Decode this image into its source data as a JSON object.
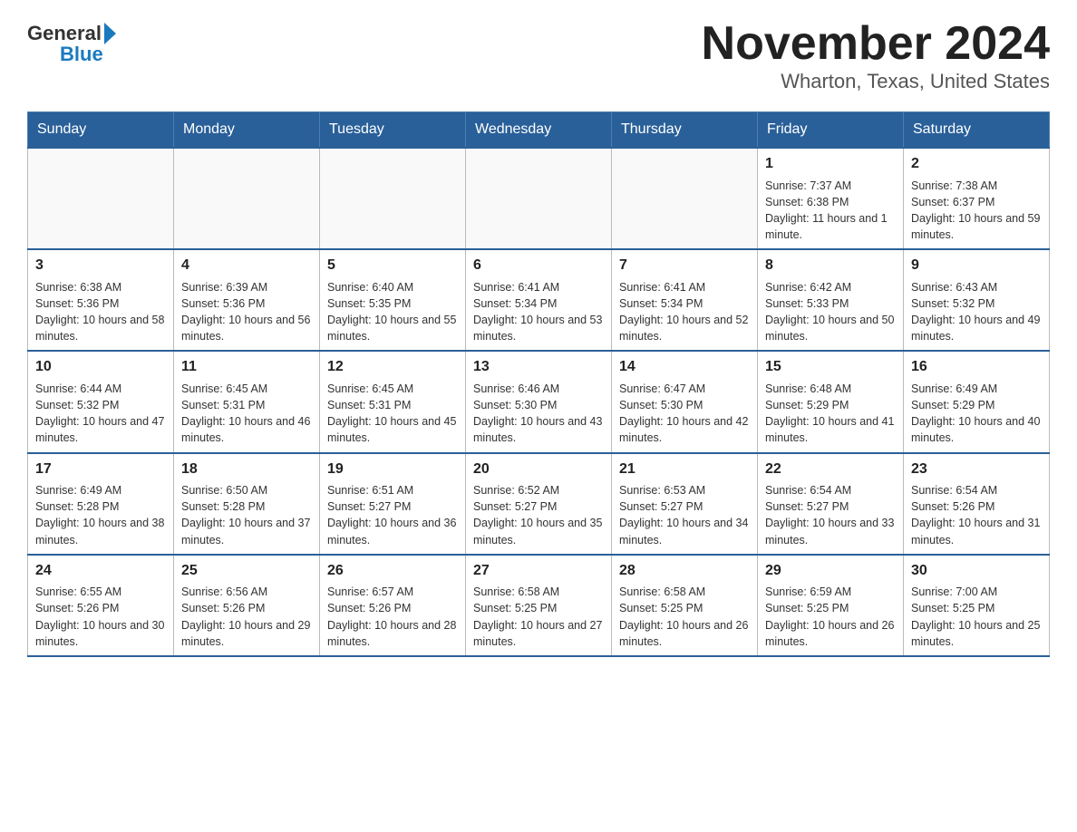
{
  "logo": {
    "general": "General",
    "blue": "Blue",
    "arrow": "▶"
  },
  "title": "November 2024",
  "subtitle": "Wharton, Texas, United States",
  "days_of_week": [
    "Sunday",
    "Monday",
    "Tuesday",
    "Wednesday",
    "Thursday",
    "Friday",
    "Saturday"
  ],
  "weeks": [
    [
      {
        "day": "",
        "info": ""
      },
      {
        "day": "",
        "info": ""
      },
      {
        "day": "",
        "info": ""
      },
      {
        "day": "",
        "info": ""
      },
      {
        "day": "",
        "info": ""
      },
      {
        "day": "1",
        "info": "Sunrise: 7:37 AM\nSunset: 6:38 PM\nDaylight: 11 hours and 1 minute."
      },
      {
        "day": "2",
        "info": "Sunrise: 7:38 AM\nSunset: 6:37 PM\nDaylight: 10 hours and 59 minutes."
      }
    ],
    [
      {
        "day": "3",
        "info": "Sunrise: 6:38 AM\nSunset: 5:36 PM\nDaylight: 10 hours and 58 minutes."
      },
      {
        "day": "4",
        "info": "Sunrise: 6:39 AM\nSunset: 5:36 PM\nDaylight: 10 hours and 56 minutes."
      },
      {
        "day": "5",
        "info": "Sunrise: 6:40 AM\nSunset: 5:35 PM\nDaylight: 10 hours and 55 minutes."
      },
      {
        "day": "6",
        "info": "Sunrise: 6:41 AM\nSunset: 5:34 PM\nDaylight: 10 hours and 53 minutes."
      },
      {
        "day": "7",
        "info": "Sunrise: 6:41 AM\nSunset: 5:34 PM\nDaylight: 10 hours and 52 minutes."
      },
      {
        "day": "8",
        "info": "Sunrise: 6:42 AM\nSunset: 5:33 PM\nDaylight: 10 hours and 50 minutes."
      },
      {
        "day": "9",
        "info": "Sunrise: 6:43 AM\nSunset: 5:32 PM\nDaylight: 10 hours and 49 minutes."
      }
    ],
    [
      {
        "day": "10",
        "info": "Sunrise: 6:44 AM\nSunset: 5:32 PM\nDaylight: 10 hours and 47 minutes."
      },
      {
        "day": "11",
        "info": "Sunrise: 6:45 AM\nSunset: 5:31 PM\nDaylight: 10 hours and 46 minutes."
      },
      {
        "day": "12",
        "info": "Sunrise: 6:45 AM\nSunset: 5:31 PM\nDaylight: 10 hours and 45 minutes."
      },
      {
        "day": "13",
        "info": "Sunrise: 6:46 AM\nSunset: 5:30 PM\nDaylight: 10 hours and 43 minutes."
      },
      {
        "day": "14",
        "info": "Sunrise: 6:47 AM\nSunset: 5:30 PM\nDaylight: 10 hours and 42 minutes."
      },
      {
        "day": "15",
        "info": "Sunrise: 6:48 AM\nSunset: 5:29 PM\nDaylight: 10 hours and 41 minutes."
      },
      {
        "day": "16",
        "info": "Sunrise: 6:49 AM\nSunset: 5:29 PM\nDaylight: 10 hours and 40 minutes."
      }
    ],
    [
      {
        "day": "17",
        "info": "Sunrise: 6:49 AM\nSunset: 5:28 PM\nDaylight: 10 hours and 38 minutes."
      },
      {
        "day": "18",
        "info": "Sunrise: 6:50 AM\nSunset: 5:28 PM\nDaylight: 10 hours and 37 minutes."
      },
      {
        "day": "19",
        "info": "Sunrise: 6:51 AM\nSunset: 5:27 PM\nDaylight: 10 hours and 36 minutes."
      },
      {
        "day": "20",
        "info": "Sunrise: 6:52 AM\nSunset: 5:27 PM\nDaylight: 10 hours and 35 minutes."
      },
      {
        "day": "21",
        "info": "Sunrise: 6:53 AM\nSunset: 5:27 PM\nDaylight: 10 hours and 34 minutes."
      },
      {
        "day": "22",
        "info": "Sunrise: 6:54 AM\nSunset: 5:27 PM\nDaylight: 10 hours and 33 minutes."
      },
      {
        "day": "23",
        "info": "Sunrise: 6:54 AM\nSunset: 5:26 PM\nDaylight: 10 hours and 31 minutes."
      }
    ],
    [
      {
        "day": "24",
        "info": "Sunrise: 6:55 AM\nSunset: 5:26 PM\nDaylight: 10 hours and 30 minutes."
      },
      {
        "day": "25",
        "info": "Sunrise: 6:56 AM\nSunset: 5:26 PM\nDaylight: 10 hours and 29 minutes."
      },
      {
        "day": "26",
        "info": "Sunrise: 6:57 AM\nSunset: 5:26 PM\nDaylight: 10 hours and 28 minutes."
      },
      {
        "day": "27",
        "info": "Sunrise: 6:58 AM\nSunset: 5:25 PM\nDaylight: 10 hours and 27 minutes."
      },
      {
        "day": "28",
        "info": "Sunrise: 6:58 AM\nSunset: 5:25 PM\nDaylight: 10 hours and 26 minutes."
      },
      {
        "day": "29",
        "info": "Sunrise: 6:59 AM\nSunset: 5:25 PM\nDaylight: 10 hours and 26 minutes."
      },
      {
        "day": "30",
        "info": "Sunrise: 7:00 AM\nSunset: 5:25 PM\nDaylight: 10 hours and 25 minutes."
      }
    ]
  ]
}
